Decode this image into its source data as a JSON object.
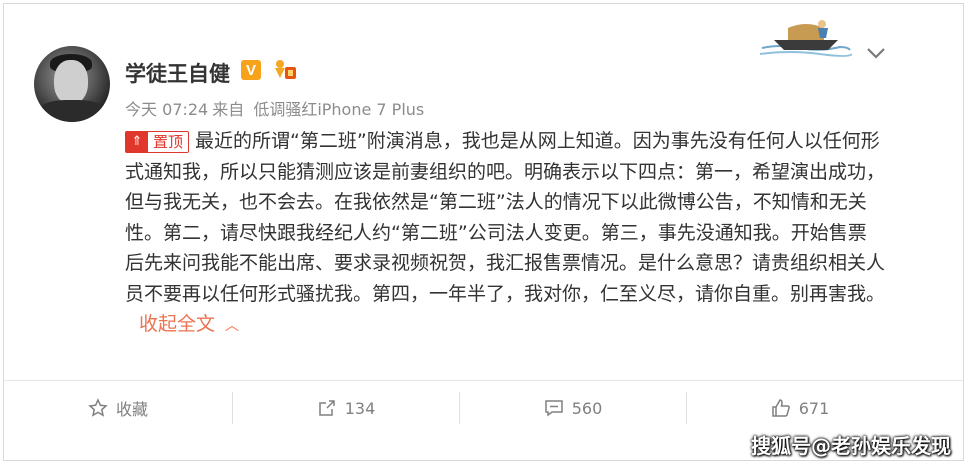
{
  "post": {
    "username": "学徒王自健",
    "v_badge": "V",
    "meta": {
      "time": "今天 07:24",
      "source_prefix": "来自",
      "source": "低调骚红iPhone 7 Plus"
    },
    "pin_label": "置顶",
    "pin_icon": "pin-icon",
    "body_text": "最近的所谓“第二班”附演消息，我也是从网上知道。因为事先没有任何人以任何形式通知我，所以只能猜测应该是前妻组织的吧。明确表示以下四点：第一，希望演出成功，但与我无关，也不会去。在我依然是“第二班”法人的情况下以此微博公告，不知情和无关性。第二，请尽快跟我经纪人约“第二班”公司法人变更。第三，事先没通知我。开始售票后先来问我能不能出席、要求录视频祝贺，我汇报售票情况。是什么意思？请贵组织相关人员不要再以任何形式骚扰我。第四，一年半了，我对你，仁至义尽，请你自重。别再害我。",
    "collapse_label": "收起全文",
    "collapse_icon": "chevron-up-icon"
  },
  "actions": [
    {
      "icon": "star-icon",
      "label": "收藏"
    },
    {
      "icon": "share-icon",
      "label": "134"
    },
    {
      "icon": "comment-icon",
      "label": "560"
    },
    {
      "icon": "thumbs-up-icon",
      "label": "671"
    }
  ],
  "watermark": "搜狐号@老孙娱乐发现",
  "colors": {
    "accent_link": "#eb7350",
    "pin_red": "#e0362b",
    "v_badge": "#f7a21b",
    "text": "#333333",
    "meta": "#8c8c8c"
  }
}
